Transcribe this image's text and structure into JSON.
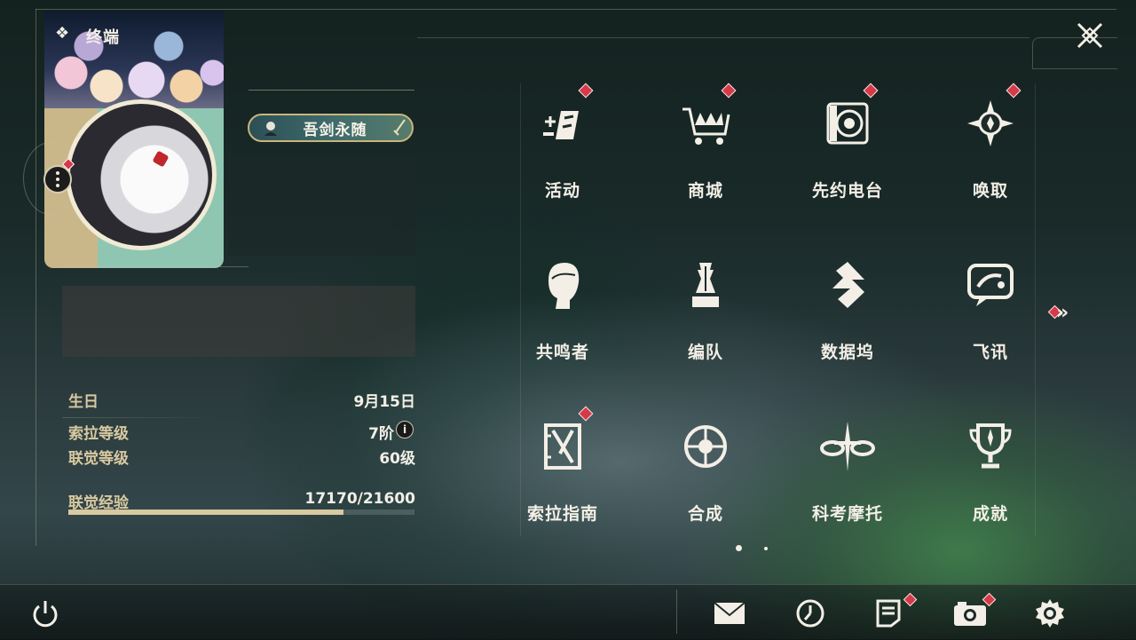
{
  "window": {
    "title": "终端",
    "title_icon": "diamond-cluster-icon"
  },
  "profile": {
    "title_badge": "吾剑永随",
    "stats": [
      {
        "label": "生日",
        "value": "9月15日"
      },
      {
        "label": "索拉等级",
        "value": "7阶"
      },
      {
        "label": "联觉等级",
        "value": "60级"
      },
      {
        "label": "联觉经验",
        "value": "17170/21600"
      }
    ],
    "xp_progress": 0.795
  },
  "grid": {
    "items": [
      {
        "label": "活动",
        "icon": "activity-icon",
        "badge": true
      },
      {
        "label": "商城",
        "icon": "shop-cart-icon",
        "badge": true
      },
      {
        "label": "先约电台",
        "icon": "radio-icon",
        "badge": true
      },
      {
        "label": "唤取",
        "icon": "convene-compass-icon",
        "badge": true
      },
      {
        "label": "共鸣者",
        "icon": "resonator-head-icon",
        "badge": false
      },
      {
        "label": "编队",
        "icon": "chess-team-icon",
        "badge": false
      },
      {
        "label": "数据坞",
        "icon": "data-dock-icon",
        "badge": false
      },
      {
        "label": "飞讯",
        "icon": "message-chat-icon",
        "badge": false
      },
      {
        "label": "索拉指南",
        "icon": "guide-book-icon",
        "badge": true
      },
      {
        "label": "合成",
        "icon": "synthesis-icon",
        "badge": false
      },
      {
        "label": "科考摩托",
        "icon": "motorcycle-icon",
        "badge": false
      },
      {
        "label": "成就",
        "icon": "trophy-icon",
        "badge": false
      }
    ],
    "next_page": "double-chevron-right-icon",
    "pages": 2,
    "current_page": 1
  },
  "bottom_bar": {
    "power": "power-icon",
    "mail": "mail-icon",
    "clock": "clock-icon",
    "notes": "notes-icon",
    "camera": "camera-icon",
    "settings": "gear-icon"
  },
  "colors": {
    "badge": "#d43a48",
    "accent": "#d8c9a0",
    "text": "#f3efe6"
  }
}
